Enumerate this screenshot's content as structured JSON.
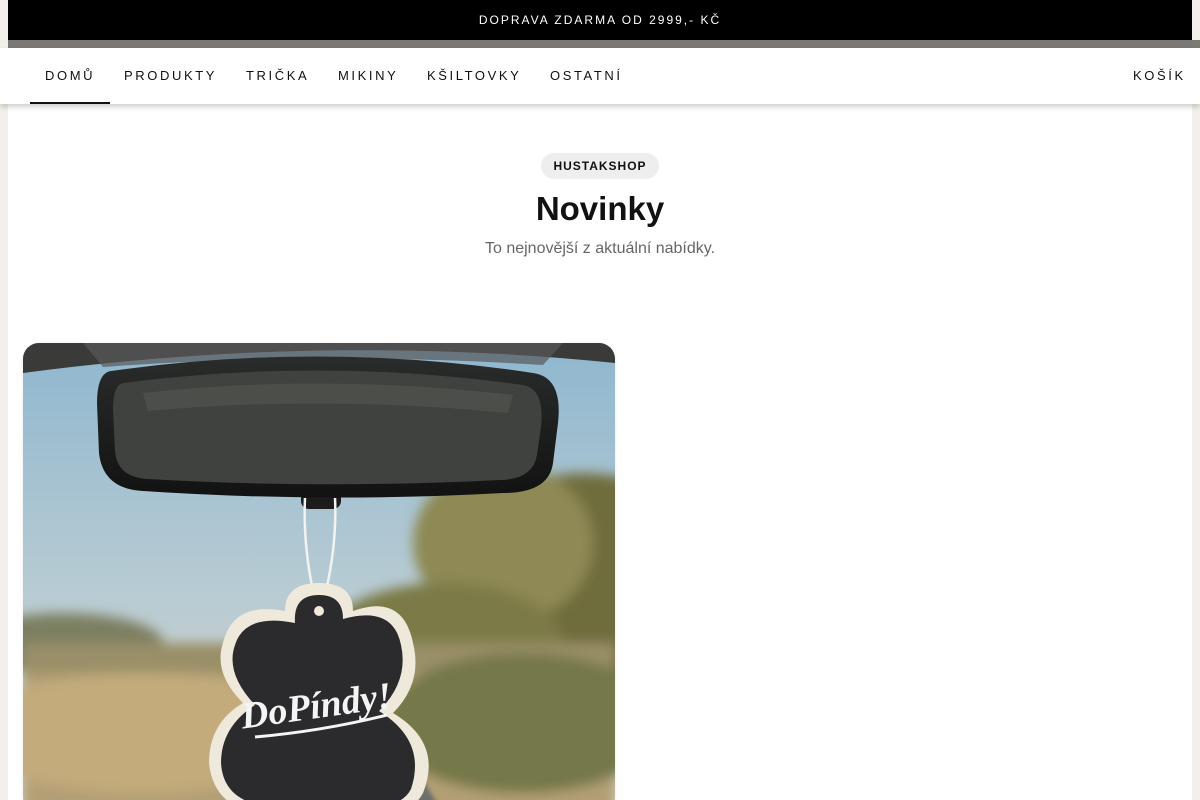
{
  "announcement": "DOPRAVA ZDARMA OD 2999,- KČ",
  "nav": {
    "items": [
      {
        "label": "DOMŮ",
        "active": true
      },
      {
        "label": "PRODUKTY"
      },
      {
        "label": "TRIČKA"
      },
      {
        "label": "MIKINY"
      },
      {
        "label": "KŠILTOVKY"
      },
      {
        "label": "OSTATNÍ"
      }
    ],
    "cart": "KOŠÍK"
  },
  "section": {
    "badge": "HUSTAKSHOP",
    "title": "Novinky",
    "subtitle": "To nejnovější z aktuální nabídky."
  },
  "product": {
    "image_text": "DoPíndy!"
  },
  "colors": {
    "topbar": "#000000",
    "accent": "#111111",
    "muted_text": "#666666",
    "background": "#f3efeb"
  }
}
